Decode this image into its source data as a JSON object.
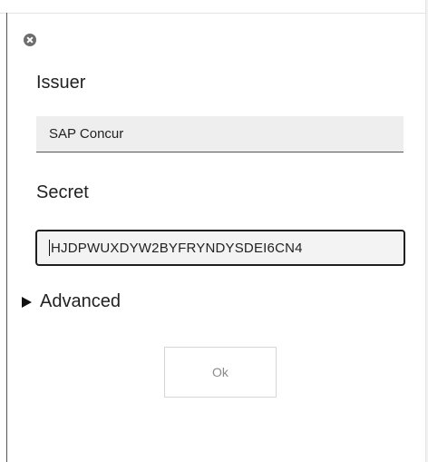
{
  "dialog": {
    "issuer": {
      "label": "Issuer",
      "value": "SAP Concur"
    },
    "secret": {
      "label": "Secret",
      "value": "HJDPWUXDYW2BYFRYNDYSDEI6CN4"
    },
    "advanced": {
      "label": "Advanced",
      "expanded": false
    },
    "ok_button": {
      "label": "Ok"
    },
    "close_icon": "close-circle-icon"
  }
}
